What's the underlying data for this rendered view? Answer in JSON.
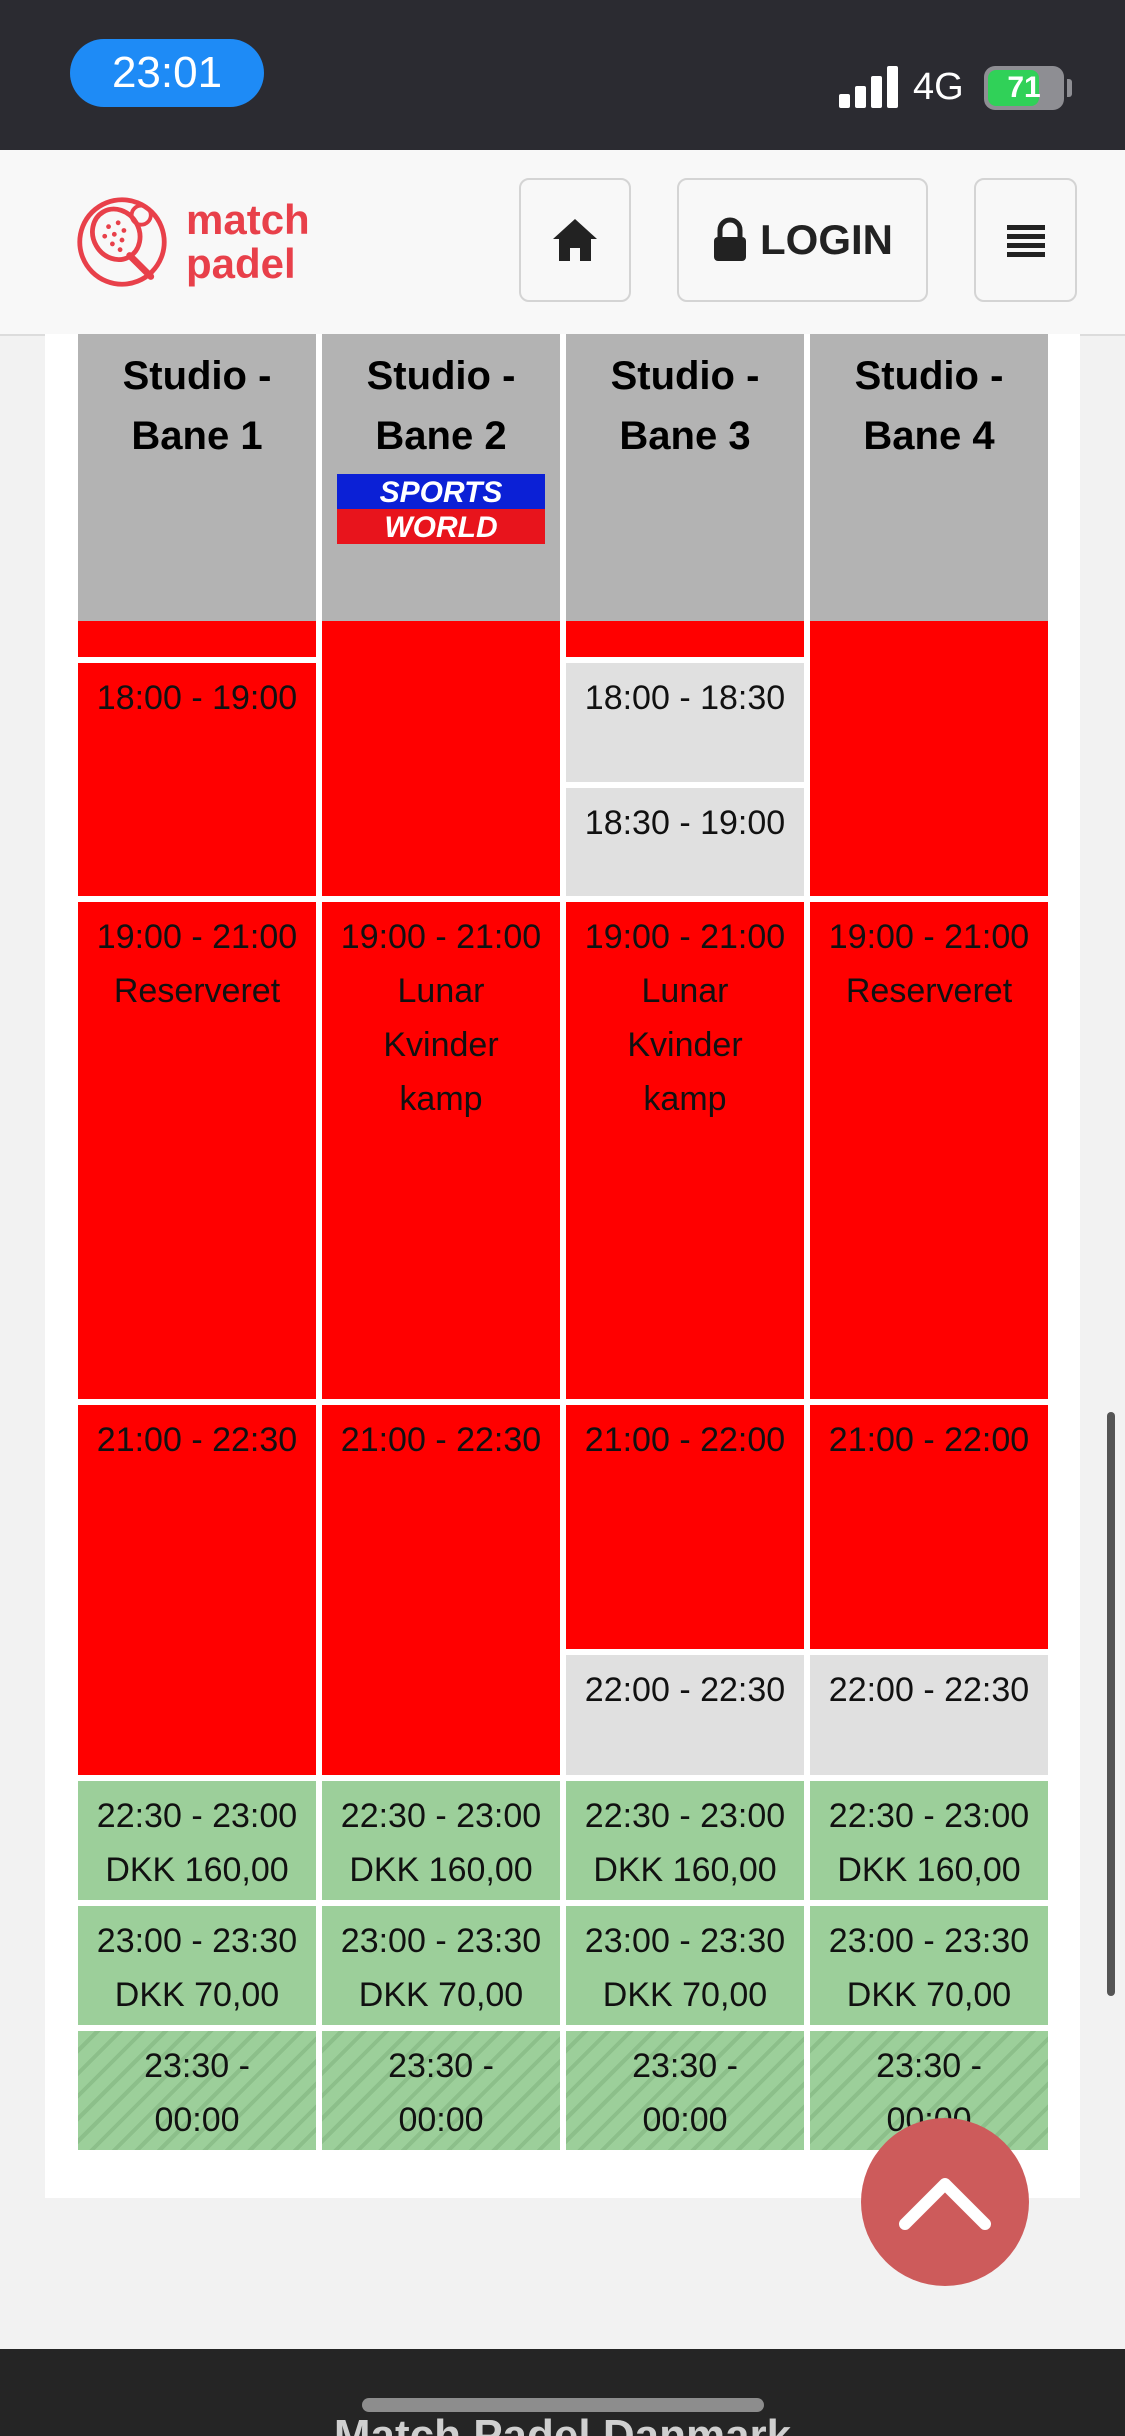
{
  "status_bar": {
    "time": "23:01",
    "network": "4G",
    "battery": "71",
    "battery_level": 0.71
  },
  "header": {
    "logo_line1": "match",
    "logo_line2": "padel",
    "login_label": "LOGIN",
    "icons": [
      "home-icon",
      "lock-icon",
      "hamburger-menu-icon"
    ]
  },
  "courts": [
    {
      "name_line1": "Studio -",
      "name_line2": "Bane 1"
    },
    {
      "name_line1": "Studio -",
      "name_line2": "Bane 2"
    },
    {
      "name_line1": "Studio -",
      "name_line2": "Bane 3"
    },
    {
      "name_line1": "Studio -",
      "name_line2": "Bane 4"
    }
  ],
  "sponsor": {
    "line1": "SPORTS",
    "line2": "WORLD"
  },
  "slots": {
    "c1": [
      {
        "time": "18:00 - 19:00",
        "status": "booked"
      },
      {
        "time": "19:00 - 21:00",
        "label": "Reserveret",
        "status": "booked"
      },
      {
        "time": "21:00 - 22:30",
        "status": "booked"
      },
      {
        "time": "22:30 - 23:00",
        "price": "DKK 160,00",
        "status": "available"
      },
      {
        "time": "23:00 - 23:30",
        "price": "DKK 70,00",
        "status": "available"
      },
      {
        "time_line1": "23:30 -",
        "time_line2": "00:00",
        "status": "closing"
      }
    ],
    "c2": [
      {
        "time": "19:00 - 21:00",
        "label_lines": [
          "Lunar",
          "Kvinder",
          "kamp"
        ],
        "status": "booked"
      },
      {
        "time": "21:00 - 22:30",
        "status": "booked"
      },
      {
        "time": "22:30 - 23:00",
        "price": "DKK 160,00",
        "status": "available"
      },
      {
        "time": "23:00 - 23:30",
        "price": "DKK 70,00",
        "status": "available"
      },
      {
        "time_line1": "23:30 -",
        "time_line2": "00:00",
        "status": "closing"
      }
    ],
    "c3": [
      {
        "time": "18:00 - 18:30",
        "status": "free"
      },
      {
        "time": "18:30 - 19:00",
        "status": "free"
      },
      {
        "time": "19:00 - 21:00",
        "label_lines": [
          "Lunar",
          "Kvinder",
          "kamp"
        ],
        "status": "booked"
      },
      {
        "time": "21:00 - 22:00",
        "status": "booked"
      },
      {
        "time": "22:00 - 22:30",
        "status": "free"
      },
      {
        "time": "22:30 - 23:00",
        "price": "DKK 160,00",
        "status": "available"
      },
      {
        "time": "23:00 - 23:30",
        "price": "DKK 70,00",
        "status": "available"
      },
      {
        "time_line1": "23:30 -",
        "time_line2": "00:00",
        "status": "closing"
      }
    ],
    "c4": [
      {
        "time": "19:00 - 21:00",
        "label": "Reserveret",
        "status": "booked"
      },
      {
        "time": "21:00 - 22:00",
        "status": "booked"
      },
      {
        "time": "22:00 - 22:30",
        "status": "free"
      },
      {
        "time": "22:30 - 23:00",
        "price": "DKK 160,00",
        "status": "available"
      },
      {
        "time": "23:00 - 23:30",
        "price": "DKK 70,00",
        "status": "available"
      },
      {
        "time_line1": "23:30 -",
        "time_line2": "00:00",
        "status": "closing"
      }
    ]
  },
  "colors": {
    "booked": "#ff0000",
    "free": "#e0e0e0",
    "available": "#9ccf9a",
    "accent": "#e8404a"
  },
  "footer": {
    "text": "Match Padel Danmark"
  }
}
